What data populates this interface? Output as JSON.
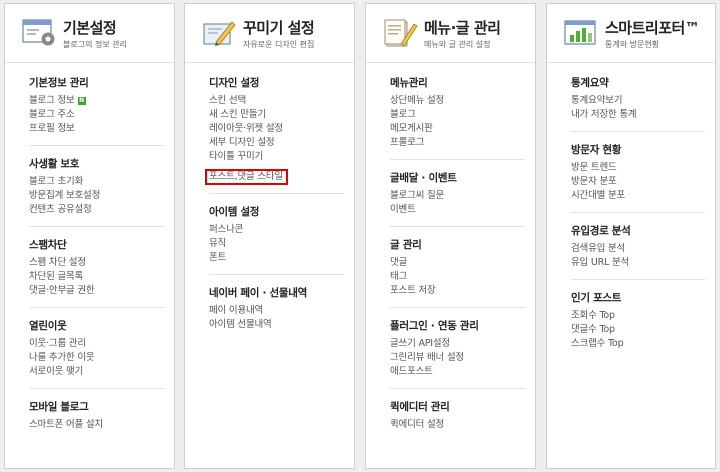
{
  "columns": [
    {
      "title": "기본설정",
      "subtitle": "블로그의 정보 관리",
      "icon": "settings-window-icon",
      "sections": [
        {
          "title": "기본정보 관리",
          "items": [
            {
              "label": "블로그 정보",
              "badge": "N"
            },
            {
              "label": "블로그 주소"
            },
            {
              "label": "프로필 정보"
            }
          ]
        },
        {
          "title": "사생활 보호",
          "items": [
            {
              "label": "블로그 초기화"
            },
            {
              "label": "방문집계 보호설정"
            },
            {
              "label": "컨텐츠 공유설정"
            }
          ]
        },
        {
          "title": "스팸차단",
          "items": [
            {
              "label": "스팸 차단 설정"
            },
            {
              "label": "차단된 글목록"
            },
            {
              "label": "댓글·안부글 권한"
            }
          ]
        },
        {
          "title": "열린이웃",
          "items": [
            {
              "label": "이웃·그룹 관리"
            },
            {
              "label": "나를 추가한 이웃"
            },
            {
              "label": "서로이웃 맺기"
            }
          ]
        },
        {
          "title": "모바일 블로그",
          "items": [
            {
              "label": "스마트폰 어플 설치"
            }
          ]
        }
      ]
    },
    {
      "title": "꾸미기 설정",
      "subtitle": "자유로운 디자인 편집",
      "icon": "design-pencil-icon",
      "sections": [
        {
          "title": "디자인 설정",
          "items": [
            {
              "label": "스킨 선택"
            },
            {
              "label": "새 스킨 만들기"
            },
            {
              "label": "레이아웃·위젯 설정"
            },
            {
              "label": "세부 디자인 설정"
            },
            {
              "label": "타이틀 꾸미기"
            },
            {
              "label": "포스트,댓글 스타일",
              "highlight": true
            }
          ]
        },
        {
          "title": "아이템 설정",
          "items": [
            {
              "label": "퍼스나콘"
            },
            {
              "label": "뮤직"
            },
            {
              "label": "폰트"
            }
          ]
        },
        {
          "title": "네이버 페이 · 선물내역",
          "items": [
            {
              "label": "페이 이용내역"
            },
            {
              "label": "아이템 선물내역"
            }
          ]
        }
      ]
    },
    {
      "title": "메뉴·글 관리",
      "subtitle": "메뉴와 글 관리 설정",
      "icon": "document-pencil-icon",
      "sections": [
        {
          "title": "메뉴관리",
          "items": [
            {
              "label": "상단메뉴 설정"
            },
            {
              "label": "블로그"
            },
            {
              "label": "메모게시판"
            },
            {
              "label": "프롤로그"
            }
          ]
        },
        {
          "title": "글배달 · 이벤트",
          "items": [
            {
              "label": "블로그씨 질문"
            },
            {
              "label": "이벤트"
            }
          ]
        },
        {
          "title": "글 관리",
          "items": [
            {
              "label": "댓글"
            },
            {
              "label": "태그"
            },
            {
              "label": "포스트 저장"
            }
          ]
        },
        {
          "title": "플러그인 · 연동 관리",
          "items": [
            {
              "label": "글쓰기 API설정"
            },
            {
              "label": "그린리뷰 배너 설정"
            },
            {
              "label": "애드포스트"
            }
          ]
        },
        {
          "title": "퀵에디터 관리",
          "items": [
            {
              "label": "퀵에디터 설정"
            }
          ]
        }
      ]
    },
    {
      "title": "스마트리포터™",
      "subtitle": "통계와 방문현황",
      "icon": "bar-chart-icon",
      "sections": [
        {
          "title": "통계요약",
          "items": [
            {
              "label": "통계요약보기"
            },
            {
              "label": "내가 저장한 통계"
            }
          ]
        },
        {
          "title": "방문자 현황",
          "items": [
            {
              "label": "방문 트렌드"
            },
            {
              "label": "방문자 분포"
            },
            {
              "label": "시간대별 분포"
            }
          ]
        },
        {
          "title": "유입경로 분석",
          "items": [
            {
              "label": "검색유입 분석"
            },
            {
              "label": "유입 URL 분석"
            }
          ]
        },
        {
          "title": "인기 포스트",
          "items": [
            {
              "label": "조회수 Top"
            },
            {
              "label": "댓글수 Top"
            },
            {
              "label": "스크랩수 Top"
            }
          ]
        }
      ]
    }
  ],
  "colors": {
    "highlight": "#e00000",
    "badge": "#3aa334",
    "border": "#cfcfcf"
  }
}
